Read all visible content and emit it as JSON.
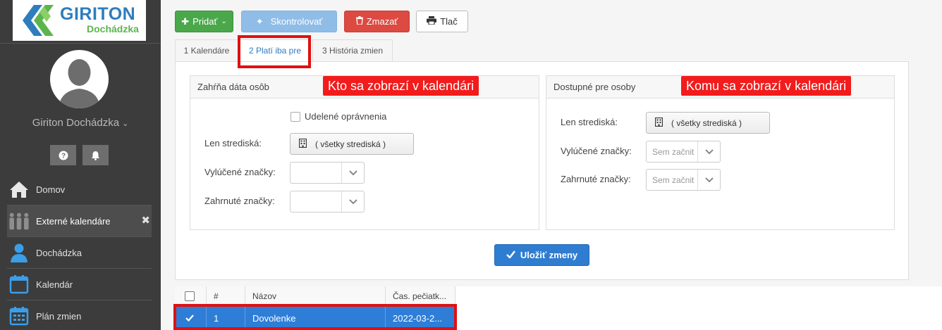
{
  "app": {
    "logo_title": "GIRITON",
    "logo_subtitle": "Dochádzka"
  },
  "sidebar": {
    "user_name": "Giriton Dochádzka",
    "items": [
      {
        "label": "Domov",
        "icon": "home-icon"
      },
      {
        "label": "Externé kalendáre",
        "icon": "people-icon",
        "active": true
      },
      {
        "label": "Dochádzka",
        "icon": "user-icon"
      },
      {
        "label": "Kalendár",
        "icon": "calendar-icon"
      },
      {
        "label": "Plán zmien",
        "icon": "calendar-grid-icon"
      }
    ]
  },
  "toolbar": {
    "add_label": "Pridať",
    "check_label": "Skontrolovať",
    "delete_label": "Zmazať",
    "print_label": "Tlač"
  },
  "tabs": [
    {
      "label": "1 Kalendáre"
    },
    {
      "label": "2 Platí iba pre",
      "active": true
    },
    {
      "label": "3 História zmien"
    }
  ],
  "left_box": {
    "title": "Zahŕňa dáta osôb",
    "annotation": "Kto sa zobrazí v kalendári",
    "checkbox_label": "Udelené oprávnenia",
    "centers_label": "Len strediská:",
    "centers_value": "( všetky strediská )",
    "excluded_label": "Vylúčené značky:",
    "excluded_value": "",
    "included_label": "Zahrnuté značky:",
    "included_value": ""
  },
  "right_box": {
    "title": "Dostupné pre osoby",
    "annotation": "Komu sa zobrazí v kalendári",
    "centers_label": "Len strediská:",
    "centers_value": "( všetky strediská )",
    "excluded_label": "Vylúčené značky:",
    "excluded_placeholder": "Sem začnit",
    "included_label": "Zahrnuté značky:",
    "included_placeholder": "Sem začnit"
  },
  "save_label": "Uložiť zmeny",
  "grid": {
    "columns": [
      "#",
      "Názov",
      "Čas. pečiatk..."
    ],
    "rows": [
      {
        "num": "1",
        "name": "Dovolenke",
        "timestamp": "2022-03-2..."
      }
    ]
  },
  "colors": {
    "accent": "#2e7ed8",
    "success": "#4aa84a",
    "danger": "#dc4a42",
    "annotation": "#f21c1c"
  }
}
